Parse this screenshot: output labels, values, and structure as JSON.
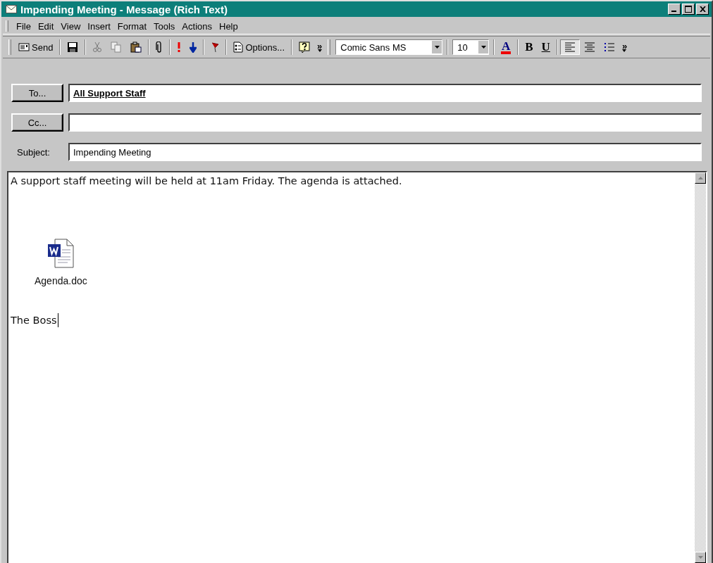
{
  "window": {
    "title": "Impending Meeting - Message (Rich Text)"
  },
  "menu": [
    {
      "label": "File"
    },
    {
      "label": "Edit"
    },
    {
      "label": "View"
    },
    {
      "label": "Insert"
    },
    {
      "label": "Format"
    },
    {
      "label": "Tools"
    },
    {
      "label": "Actions"
    },
    {
      "label": "Help"
    }
  ],
  "toolbar": {
    "send": "Send",
    "options": "Options...",
    "more": "»",
    "font": "Comic Sans MS",
    "size": "10",
    "format_buttons": [
      {
        "kind": "color",
        "label": "A",
        "pressed": false
      },
      {
        "kind": "bold",
        "label": "B",
        "pressed": false
      },
      {
        "kind": "underline",
        "label": "U",
        "pressed": false
      },
      {
        "kind": "align-left",
        "pressed": true
      },
      {
        "kind": "center",
        "pressed": false
      },
      {
        "kind": "bullets",
        "pressed": false
      }
    ],
    "more_format": "»"
  },
  "headers": [
    {
      "kind": "button",
      "label": "To...",
      "value": "All Support Staff",
      "resolved": true
    },
    {
      "kind": "button",
      "label": "Cc..."
    },
    {
      "kind": "label",
      "label": "Subject:",
      "value": "Impending Meeting",
      "resolved": false
    }
  ],
  "body": {
    "text": "A support staff meeting will be held at 11am Friday. The agenda is attached.",
    "attachment": {
      "name": "Agenda.doc"
    },
    "signature": "The Boss"
  }
}
